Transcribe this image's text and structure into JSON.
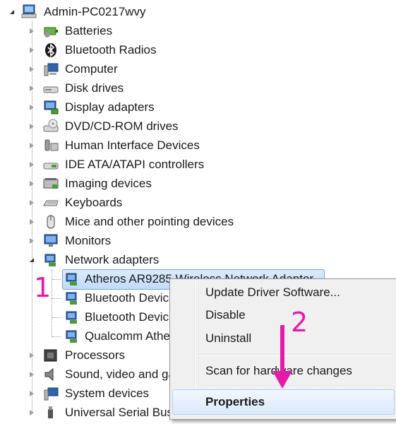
{
  "tree": {
    "root": "Admin-PC0217wvy",
    "categories": [
      {
        "label": "Batteries",
        "icon": "battery-icon"
      },
      {
        "label": "Bluetooth Radios",
        "icon": "bluetooth-icon"
      },
      {
        "label": "Computer",
        "icon": "computer-icon"
      },
      {
        "label": "Disk drives",
        "icon": "disk-drive-icon"
      },
      {
        "label": "Display adapters",
        "icon": "display-adapter-icon"
      },
      {
        "label": "DVD/CD-ROM drives",
        "icon": "dvd-drive-icon"
      },
      {
        "label": "Human Interface Devices",
        "icon": "hid-icon"
      },
      {
        "label": "IDE ATA/ATAPI controllers",
        "icon": "ide-controller-icon"
      },
      {
        "label": "Imaging devices",
        "icon": "imaging-device-icon"
      },
      {
        "label": "Keyboards",
        "icon": "keyboard-icon"
      },
      {
        "label": "Mice and other pointing devices",
        "icon": "mouse-icon"
      },
      {
        "label": "Monitors",
        "icon": "monitor-icon"
      },
      {
        "label": "Network adapters",
        "icon": "network-adapter-icon"
      }
    ],
    "network_children": [
      "Atheros AR9285 Wireless Network Adapter",
      "Bluetooth Device (Personal Area Network)",
      "Bluetooth Device (RFCOMM Protocol TDI)",
      "Qualcomm Atheros"
    ],
    "after": [
      {
        "label": "Processors",
        "icon": "processor-icon"
      },
      {
        "label": "Sound, video and game controllers",
        "icon": "sound-icon"
      },
      {
        "label": "System devices",
        "icon": "system-device-icon"
      },
      {
        "label": "Universal Serial Bus controllers",
        "icon": "usb-icon"
      }
    ]
  },
  "context_menu": {
    "items": [
      "Update Driver Software...",
      "Disable",
      "Uninstall",
      "Scan for hardware changes",
      "Properties"
    ]
  },
  "annotations": {
    "step1": "1",
    "step2": "2"
  },
  "colors": {
    "annotation": "#e61aa8",
    "selection": "#c1dbfc"
  }
}
